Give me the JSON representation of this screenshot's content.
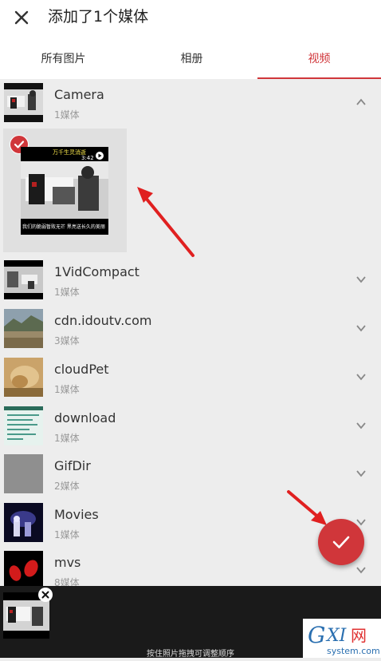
{
  "header": {
    "title": "添加了1个媒体",
    "close_icon": "close-icon"
  },
  "tabs": [
    {
      "label": "所有图片",
      "active": false
    },
    {
      "label": "相册",
      "active": false
    },
    {
      "label": "视频",
      "active": true
    }
  ],
  "albums": [
    {
      "name": "Camera",
      "count": "1媒体",
      "expanded": true
    },
    {
      "name": "1VidCompact",
      "count": "1媒体",
      "expanded": false
    },
    {
      "name": "cdn.idoutv.com",
      "count": "3媒体",
      "expanded": false
    },
    {
      "name": "cloudPet",
      "count": "1媒体",
      "expanded": false
    },
    {
      "name": "download",
      "count": "1媒体",
      "expanded": false
    },
    {
      "name": "GifDir",
      "count": "2媒体",
      "expanded": false
    },
    {
      "name": "Movies",
      "count": "1媒体",
      "expanded": false
    },
    {
      "name": "mvs",
      "count": "8媒体",
      "expanded": false
    }
  ],
  "media_item": {
    "selected": true,
    "caption_top": "万千生灵消逝",
    "duration": "3:42",
    "caption_bottom": "我们的脆弱暂败无芒 黑亮送长久的美丽"
  },
  "bottom": {
    "hint": "按住照片拖拽可调整顺序"
  },
  "watermark": {
    "text": "GXI网",
    "sub": "system.com"
  },
  "colors": {
    "accent": "#d0363a",
    "bg": "#ededed",
    "bar": "#1a1a1a"
  }
}
